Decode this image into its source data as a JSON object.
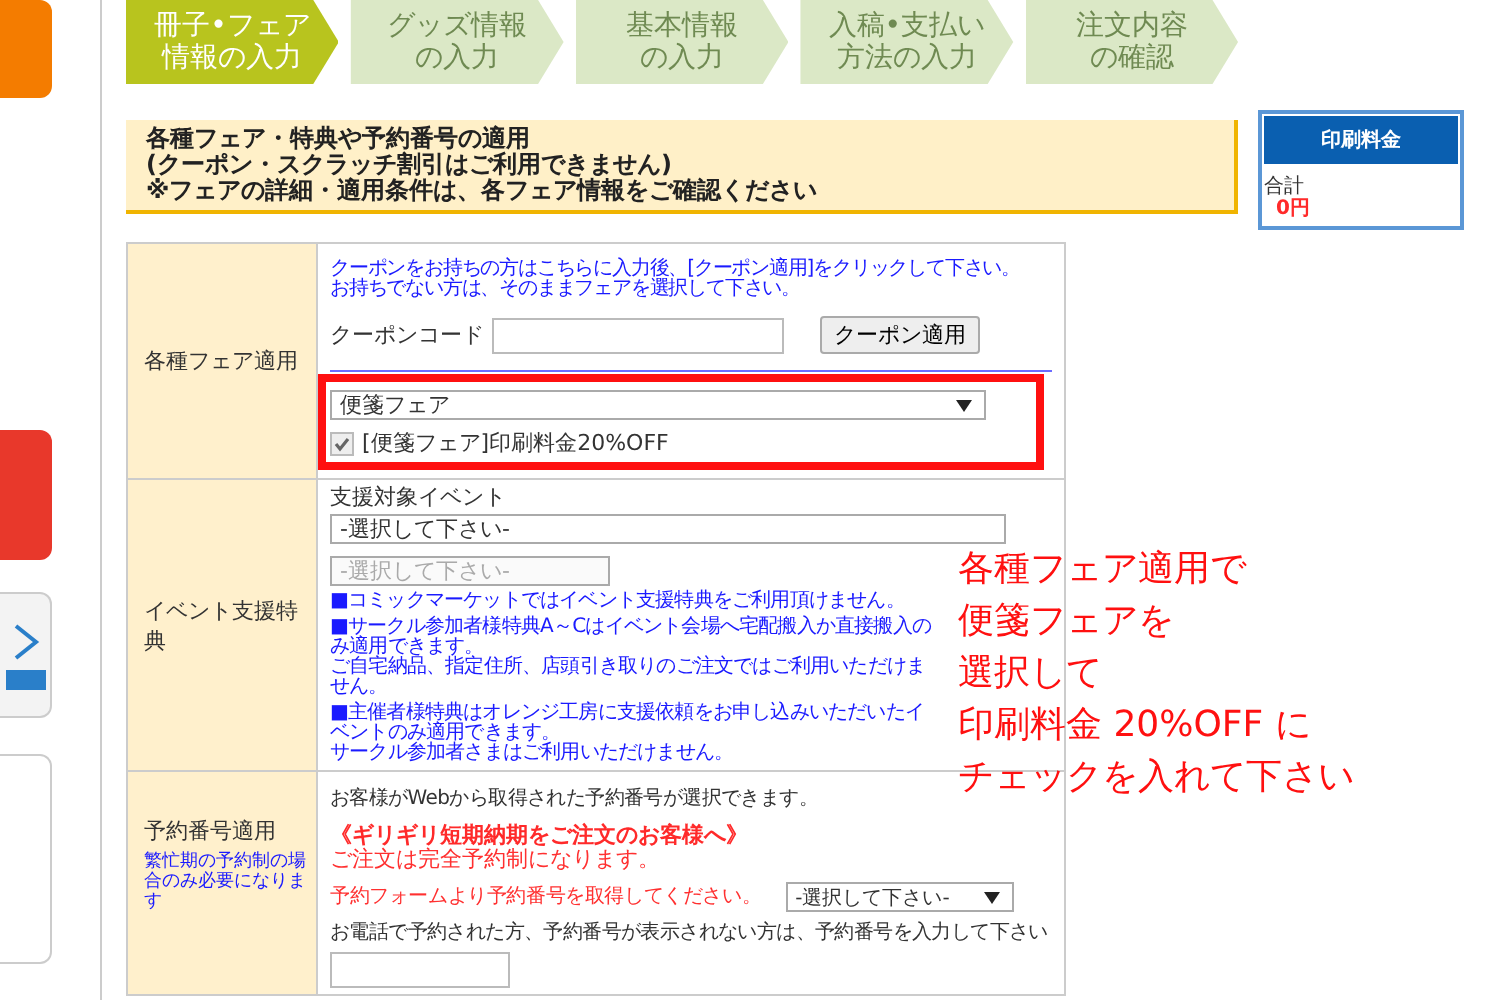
{
  "steps": [
    {
      "lines": [
        "冊子•フェア",
        "情報の入力"
      ],
      "selected": true
    },
    {
      "lines": [
        "グッズ情報",
        "の入力"
      ],
      "selected": false
    },
    {
      "lines": [
        "基本情報",
        "の入力"
      ],
      "selected": false
    },
    {
      "lines": [
        "入稿•支払い",
        "方法の入力"
      ],
      "selected": false
    },
    {
      "lines": [
        "注文内容",
        "の確認"
      ],
      "selected": false
    }
  ],
  "notice": {
    "lines": [
      "各種フェア・特典や予約番号の適用",
      "(クーポン・スクラッチ割引はご利用できません)",
      "※フェアの詳細・適用条件は、各フェア情報をご確認ください"
    ]
  },
  "price_box": {
    "title": "印刷料金",
    "total_label": "合計",
    "total_value": "0円"
  },
  "fair_row": {
    "label": "各種フェア適用",
    "instructions": [
      "クーポンをお持ちの方はこちらに入力後、[クーポン適用]をクリックして下さい。",
      "お持ちでない方は、そのままフェアを選択して下さい。"
    ],
    "coupon_label": "クーポンコード",
    "coupon_button": "クーポン適用",
    "fair_select": "便箋フェア",
    "discount_option": {
      "label": "[便箋フェア]印刷料金20%OFF",
      "checked": true
    }
  },
  "event_row": {
    "label": "イベント支援特典",
    "heading": "支援対象イベント",
    "selects": [
      {
        "value": "-選択して下さい-",
        "disabled": false
      },
      {
        "value": "-選択して下さい-",
        "disabled": true
      }
    ],
    "notes": [
      [
        "■コミックマーケットではイベント支援特典をご利用頂けません。"
      ],
      [
        "■サークル参加者様特典A～Cはイベント会場へ宅配搬入か直接搬入のみ適用できます。",
        "ご自宅納品、指定住所、店頭引き取りのご注文ではご利用いただけません。"
      ],
      [
        "■主催者様特典はオレンジ工房に支援依頼をお申し込みいただいたイベントのみ適用できます。",
        "サークル参加者さまはご利用いただけません。"
      ]
    ]
  },
  "reservation_row": {
    "label": "予約番号適用",
    "sublabel": "繁忙期の予約制の場合のみ必要になります",
    "intro": "お客様がWebから取得された予約番号が選択できます。",
    "warning_title": "《ギリギリ短期納期をご注文のお客様へ》",
    "warning_text": "ご注文は完全予約制になります。",
    "form_prompt": "予約フォームより予約番号を取得してください。",
    "select": "-選択して下さい-",
    "phone_note": "お電話で予約された方、予約番号が表示されない方は、予約番号を入力して下さい"
  },
  "annotation": {
    "lines": [
      "各種フェア適用で",
      "便箋フェアを",
      "選択して",
      "印刷料金 20%OFF に",
      "チェックを入れて下さい"
    ]
  }
}
